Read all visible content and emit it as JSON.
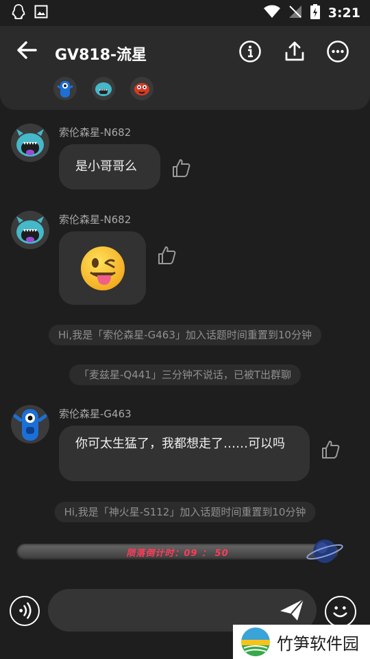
{
  "status_bar": {
    "time": "3:21"
  },
  "header": {
    "title": "GV818-流星",
    "icons": [
      "back-arrow-icon",
      "info-icon",
      "share-icon",
      "more-icon"
    ]
  },
  "messages": [
    {
      "sender": "索伦森星-N682",
      "text": "是小哥哥么"
    },
    {
      "sender": "索伦森星-N682",
      "emoji": "😜"
    },
    {
      "sender": "索伦森星-G463",
      "text": "你可太生猛了，我都想走了……可以吗"
    }
  ],
  "system": [
    "Hi,我是「索伦森星-G463」加入话题时间重置到10分钟",
    "「麦兹星-Q441」三分钟不说话，已被T出群聊",
    "Hi,我是「神火星-S112」加入话题时间重置到10分钟"
  ],
  "countdown": {
    "label": "陨落倒计时：",
    "time": "09 ： 50"
  },
  "input": {
    "placeholder": ""
  },
  "watermark": {
    "text": "竹笋软件园"
  },
  "colors": {
    "background": "#1e1e1e",
    "bubble": "#323232",
    "countdown_text": "#ff3b57"
  }
}
